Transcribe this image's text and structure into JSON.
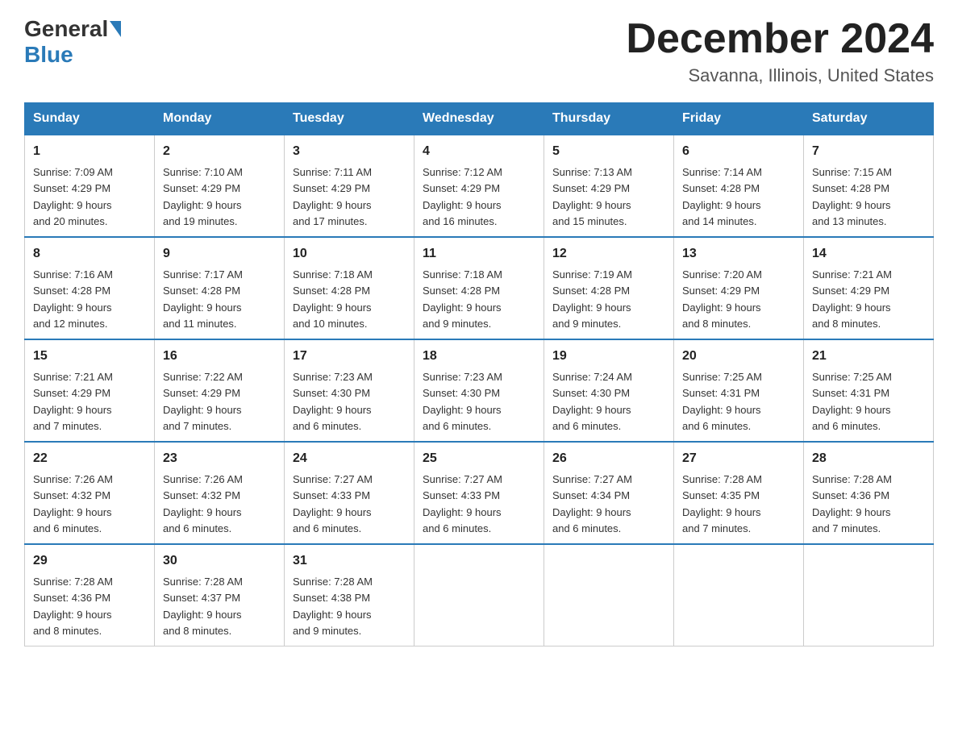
{
  "header": {
    "logo": {
      "general": "General",
      "blue": "Blue"
    },
    "title": "December 2024",
    "location": "Savanna, Illinois, United States"
  },
  "days_of_week": [
    "Sunday",
    "Monday",
    "Tuesday",
    "Wednesday",
    "Thursday",
    "Friday",
    "Saturday"
  ],
  "weeks": [
    [
      {
        "day": "1",
        "sunrise": "7:09 AM",
        "sunset": "4:29 PM",
        "daylight": "9 hours and 20 minutes."
      },
      {
        "day": "2",
        "sunrise": "7:10 AM",
        "sunset": "4:29 PM",
        "daylight": "9 hours and 19 minutes."
      },
      {
        "day": "3",
        "sunrise": "7:11 AM",
        "sunset": "4:29 PM",
        "daylight": "9 hours and 17 minutes."
      },
      {
        "day": "4",
        "sunrise": "7:12 AM",
        "sunset": "4:29 PM",
        "daylight": "9 hours and 16 minutes."
      },
      {
        "day": "5",
        "sunrise": "7:13 AM",
        "sunset": "4:29 PM",
        "daylight": "9 hours and 15 minutes."
      },
      {
        "day": "6",
        "sunrise": "7:14 AM",
        "sunset": "4:28 PM",
        "daylight": "9 hours and 14 minutes."
      },
      {
        "day": "7",
        "sunrise": "7:15 AM",
        "sunset": "4:28 PM",
        "daylight": "9 hours and 13 minutes."
      }
    ],
    [
      {
        "day": "8",
        "sunrise": "7:16 AM",
        "sunset": "4:28 PM",
        "daylight": "9 hours and 12 minutes."
      },
      {
        "day": "9",
        "sunrise": "7:17 AM",
        "sunset": "4:28 PM",
        "daylight": "9 hours and 11 minutes."
      },
      {
        "day": "10",
        "sunrise": "7:18 AM",
        "sunset": "4:28 PM",
        "daylight": "9 hours and 10 minutes."
      },
      {
        "day": "11",
        "sunrise": "7:18 AM",
        "sunset": "4:28 PM",
        "daylight": "9 hours and 9 minutes."
      },
      {
        "day": "12",
        "sunrise": "7:19 AM",
        "sunset": "4:28 PM",
        "daylight": "9 hours and 9 minutes."
      },
      {
        "day": "13",
        "sunrise": "7:20 AM",
        "sunset": "4:29 PM",
        "daylight": "9 hours and 8 minutes."
      },
      {
        "day": "14",
        "sunrise": "7:21 AM",
        "sunset": "4:29 PM",
        "daylight": "9 hours and 8 minutes."
      }
    ],
    [
      {
        "day": "15",
        "sunrise": "7:21 AM",
        "sunset": "4:29 PM",
        "daylight": "9 hours and 7 minutes."
      },
      {
        "day": "16",
        "sunrise": "7:22 AM",
        "sunset": "4:29 PM",
        "daylight": "9 hours and 7 minutes."
      },
      {
        "day": "17",
        "sunrise": "7:23 AM",
        "sunset": "4:30 PM",
        "daylight": "9 hours and 6 minutes."
      },
      {
        "day": "18",
        "sunrise": "7:23 AM",
        "sunset": "4:30 PM",
        "daylight": "9 hours and 6 minutes."
      },
      {
        "day": "19",
        "sunrise": "7:24 AM",
        "sunset": "4:30 PM",
        "daylight": "9 hours and 6 minutes."
      },
      {
        "day": "20",
        "sunrise": "7:25 AM",
        "sunset": "4:31 PM",
        "daylight": "9 hours and 6 minutes."
      },
      {
        "day": "21",
        "sunrise": "7:25 AM",
        "sunset": "4:31 PM",
        "daylight": "9 hours and 6 minutes."
      }
    ],
    [
      {
        "day": "22",
        "sunrise": "7:26 AM",
        "sunset": "4:32 PM",
        "daylight": "9 hours and 6 minutes."
      },
      {
        "day": "23",
        "sunrise": "7:26 AM",
        "sunset": "4:32 PM",
        "daylight": "9 hours and 6 minutes."
      },
      {
        "day": "24",
        "sunrise": "7:27 AM",
        "sunset": "4:33 PM",
        "daylight": "9 hours and 6 minutes."
      },
      {
        "day": "25",
        "sunrise": "7:27 AM",
        "sunset": "4:33 PM",
        "daylight": "9 hours and 6 minutes."
      },
      {
        "day": "26",
        "sunrise": "7:27 AM",
        "sunset": "4:34 PM",
        "daylight": "9 hours and 6 minutes."
      },
      {
        "day": "27",
        "sunrise": "7:28 AM",
        "sunset": "4:35 PM",
        "daylight": "9 hours and 7 minutes."
      },
      {
        "day": "28",
        "sunrise": "7:28 AM",
        "sunset": "4:36 PM",
        "daylight": "9 hours and 7 minutes."
      }
    ],
    [
      {
        "day": "29",
        "sunrise": "7:28 AM",
        "sunset": "4:36 PM",
        "daylight": "9 hours and 8 minutes."
      },
      {
        "day": "30",
        "sunrise": "7:28 AM",
        "sunset": "4:37 PM",
        "daylight": "9 hours and 8 minutes."
      },
      {
        "day": "31",
        "sunrise": "7:28 AM",
        "sunset": "4:38 PM",
        "daylight": "9 hours and 9 minutes."
      },
      null,
      null,
      null,
      null
    ]
  ],
  "labels": {
    "sunrise": "Sunrise:",
    "sunset": "Sunset:",
    "daylight": "Daylight:"
  }
}
